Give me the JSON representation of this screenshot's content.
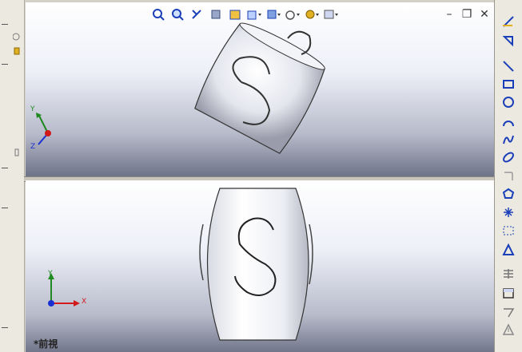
{
  "window": {
    "minimize_glyph": "–",
    "restore_glyph": "❐",
    "close_glyph": "✕"
  },
  "view_toolbar": {
    "icons": [
      "zoom-to-fit-icon",
      "zoom-area-icon",
      "previous-view-icon",
      "section-view-icon",
      "view-orientation-icon",
      "display-style-icon",
      "hide-show-items-icon",
      "edit-appearance-icon",
      "apply-scene-icon",
      "view-settings-icon"
    ]
  },
  "sketch_toolbar": {
    "icons": [
      "sketch-icon",
      "smart-dimension-icon",
      "line-icon",
      "rectangle-icon",
      "circle-icon",
      "arc-icon",
      "spline-icon",
      "ellipse-icon",
      "fillet-icon",
      "polygon-icon",
      "point-icon",
      "centerline-icon",
      "text-icon",
      "convert-entities-icon",
      "offset-entities-icon",
      "trim-icon",
      "mirror-icon",
      "warning-icon"
    ]
  },
  "triad": {
    "top_axes": [
      "Y",
      "Z"
    ],
    "bottom_axes": [
      "Y",
      "X"
    ]
  },
  "viewports": {
    "bottom_label": "*前視"
  },
  "model": {
    "letter": "S"
  },
  "colors": {
    "x_axis": "#d21a1a",
    "y_axis": "#1f8a1f",
    "z_axis": "#1a2fd2",
    "toolbar_icon": "#1b3fb8"
  }
}
